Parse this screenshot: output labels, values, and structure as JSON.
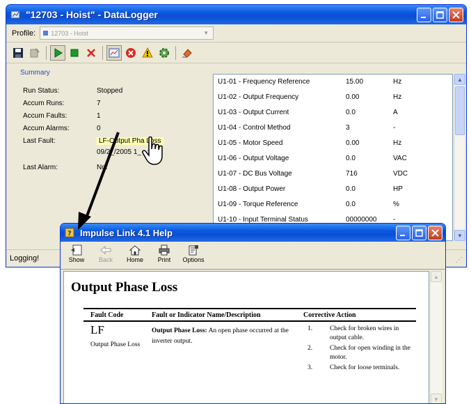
{
  "main_window": {
    "title": "\"12703 - Hoist\" - DataLogger",
    "profile_label": "Profile:",
    "profile_value": "12703 - Hoist"
  },
  "summary": {
    "title": "Summary",
    "rows": [
      {
        "label": "Run Status:",
        "value": "Stopped"
      },
      {
        "label": "Accum Runs:",
        "value": "7"
      },
      {
        "label": "Accum Faults:",
        "value": "1"
      },
      {
        "label": "Accum Alarms:",
        "value": "0"
      },
      {
        "label": "Last Fault:",
        "value": "LF-Output Pha Loss",
        "value2": "09/2_/2005 1_ _:50"
      },
      {
        "label": "Last Alarm:",
        "value": "Nor"
      }
    ]
  },
  "monitor_table": {
    "rows": [
      {
        "name": "U1-01 - Frequency Reference",
        "value": "15.00",
        "unit": "Hz"
      },
      {
        "name": "U1-02 - Output Frequency",
        "value": "0.00",
        "unit": "Hz"
      },
      {
        "name": "U1-03 - Output Current",
        "value": "0.0",
        "unit": "A"
      },
      {
        "name": "U1-04 - Control Method",
        "value": "3",
        "unit": "-"
      },
      {
        "name": "U1-05 - Motor Speed",
        "value": "0.00",
        "unit": "Hz"
      },
      {
        "name": "U1-06 - Output Voltage",
        "value": "0.0",
        "unit": "VAC"
      },
      {
        "name": "U1-07 - DC Bus Voltage",
        "value": "716",
        "unit": "VDC"
      },
      {
        "name": "U1-08 - Output Power",
        "value": "0.0",
        "unit": "HP"
      },
      {
        "name": "U1-09 - Torque Reference",
        "value": "0.0",
        "unit": "%"
      },
      {
        "name": "U1-10 - Input Terminal Status",
        "value": "00000000",
        "unit": "-"
      }
    ]
  },
  "status": {
    "text": "Logging!"
  },
  "help_window": {
    "title": "Impulse Link 4.1 Help",
    "toolbar": [
      {
        "label": "Show",
        "icon": "show-icon"
      },
      {
        "label": "Back",
        "icon": "back-arrow-icon"
      },
      {
        "label": "Home",
        "icon": "home-icon"
      },
      {
        "label": "Print",
        "icon": "printer-icon"
      },
      {
        "label": "Options",
        "icon": "options-icon"
      }
    ],
    "page_title": "Output Phase Loss",
    "table": {
      "headers": [
        "Fault Code",
        "Fault or Indicator Name/Description",
        "Corrective Action"
      ],
      "code": "LF",
      "code_name": "Output Phase Loss",
      "desc_bold": "Output Phase Loss:",
      "desc_text": " An open phase occurred at the inverter output.",
      "actions": [
        {
          "num": "1.",
          "text": "Check for broken wires in output cable."
        },
        {
          "num": "2.",
          "text": "Check for open winding in the motor."
        },
        {
          "num": "3.",
          "text": "Check for loose terminals."
        }
      ]
    }
  },
  "colors": {
    "titlebar": "#0a57e0",
    "summary_title": "#2151b5",
    "fault_highlight": "#ffffb0"
  }
}
